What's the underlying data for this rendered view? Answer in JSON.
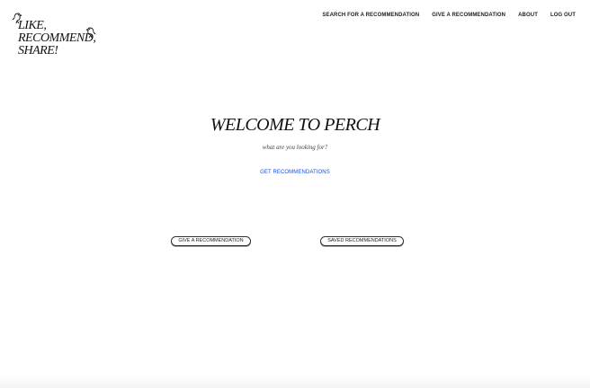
{
  "logo": {
    "lines": [
      "LIKE,",
      "RECOMMEND,",
      "SHARE!"
    ]
  },
  "nav": {
    "search": "SEARCH FOR A RECOMMENDATION",
    "give": "GIVE A RECOMMENDATION",
    "about": "ABOUT",
    "logout": "LOG OUT"
  },
  "main": {
    "title": "WELCOME TO PERCH",
    "subtitle": "what are you looking for?",
    "get_recommendations": "GET RECOMMENDATIONS"
  },
  "buttons": {
    "give": "GIVE A RECOMMENDATION",
    "saved": "SAVED RECOMMENDATIONS"
  }
}
